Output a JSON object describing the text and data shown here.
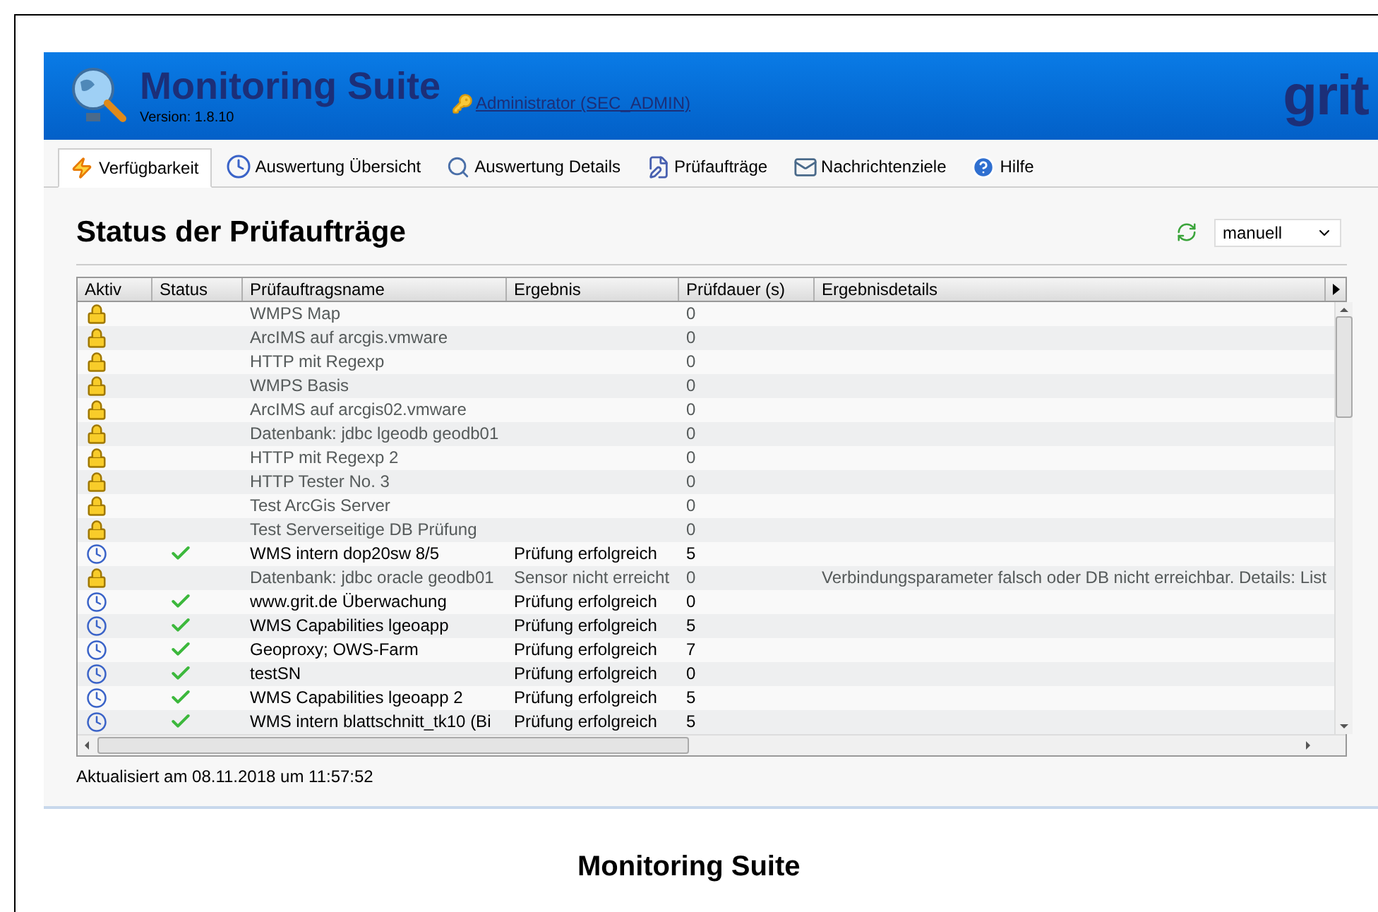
{
  "app": {
    "title": "Monitoring Suite",
    "version": "Version: 1.8.10",
    "user_link": "Administrator (SEC_ADMIN)",
    "brand": "grit"
  },
  "tabs": [
    {
      "label": "Verfügbarkeit",
      "kind": "bolt",
      "selected": true
    },
    {
      "label": "Auswertung Übersicht",
      "kind": "clock",
      "selected": false
    },
    {
      "label": "Auswertung Details",
      "kind": "search",
      "selected": false
    },
    {
      "label": "Prüfaufträge",
      "kind": "edit",
      "selected": false
    },
    {
      "label": "Nachrichtenziele",
      "kind": "mail",
      "selected": false
    },
    {
      "label": "Hilfe",
      "kind": "help",
      "selected": false
    }
  ],
  "heading": "Status der Prüfaufträge",
  "refresh_select": {
    "value": "manuell"
  },
  "table": {
    "columns": [
      "Aktiv",
      "Status",
      "Prüfauftragsname",
      "Ergebnis",
      "Prüfdauer (s)",
      "Ergebnisdetails"
    ],
    "rows": [
      {
        "active": false,
        "ok": false,
        "name": "WMPS Map",
        "result": "",
        "duration": "0",
        "details": ""
      },
      {
        "active": false,
        "ok": false,
        "name": "ArcIMS auf arcgis.vmware",
        "result": "",
        "duration": "0",
        "details": ""
      },
      {
        "active": false,
        "ok": false,
        "name": "HTTP mit Regexp",
        "result": "",
        "duration": "0",
        "details": ""
      },
      {
        "active": false,
        "ok": false,
        "name": "WMPS Basis",
        "result": "",
        "duration": "0",
        "details": ""
      },
      {
        "active": false,
        "ok": false,
        "name": "ArcIMS auf arcgis02.vmware",
        "result": "",
        "duration": "0",
        "details": ""
      },
      {
        "active": false,
        "ok": false,
        "name": "Datenbank: jdbc lgeodb geodb01",
        "result": "",
        "duration": "0",
        "details": ""
      },
      {
        "active": false,
        "ok": false,
        "name": "HTTP mit Regexp 2",
        "result": "",
        "duration": "0",
        "details": ""
      },
      {
        "active": false,
        "ok": false,
        "name": "HTTP Tester No. 3",
        "result": "",
        "duration": "0",
        "details": ""
      },
      {
        "active": false,
        "ok": false,
        "name": "Test ArcGis Server",
        "result": "",
        "duration": "0",
        "details": ""
      },
      {
        "active": false,
        "ok": false,
        "name": "Test Serverseitige DB Prüfung",
        "result": "",
        "duration": "0",
        "details": ""
      },
      {
        "active": true,
        "ok": true,
        "name": "WMS intern dop20sw 8/5",
        "result": "Prüfung erfolgreich",
        "duration": "5",
        "details": ""
      },
      {
        "active": false,
        "ok": false,
        "name": "Datenbank: jdbc oracle geodb01",
        "result": "Sensor nicht erreicht",
        "duration": "0",
        "details": "Verbindungsparameter falsch oder DB nicht erreichbar. Details: List"
      },
      {
        "active": true,
        "ok": true,
        "name": "www.grit.de Überwachung",
        "result": "Prüfung erfolgreich",
        "duration": "0",
        "details": ""
      },
      {
        "active": true,
        "ok": true,
        "name": "WMS Capabilities lgeoapp",
        "result": "Prüfung erfolgreich",
        "duration": "5",
        "details": ""
      },
      {
        "active": true,
        "ok": true,
        "name": "Geoproxy; OWS-Farm",
        "result": "Prüfung erfolgreich",
        "duration": "7",
        "details": ""
      },
      {
        "active": true,
        "ok": true,
        "name": "testSN",
        "result": "Prüfung erfolgreich",
        "duration": "0",
        "details": ""
      },
      {
        "active": true,
        "ok": true,
        "name": "WMS Capabilities lgeoapp 2",
        "result": "Prüfung erfolgreich",
        "duration": "5",
        "details": ""
      },
      {
        "active": true,
        "ok": true,
        "name": "WMS intern blattschnitt_tk10 (Bi",
        "result": "Prüfung erfolgreich",
        "duration": "5",
        "details": ""
      }
    ]
  },
  "status_bar": "Aktualisiert am 08.11.2018 um 11:57:52",
  "caption": "Monitoring Suite"
}
